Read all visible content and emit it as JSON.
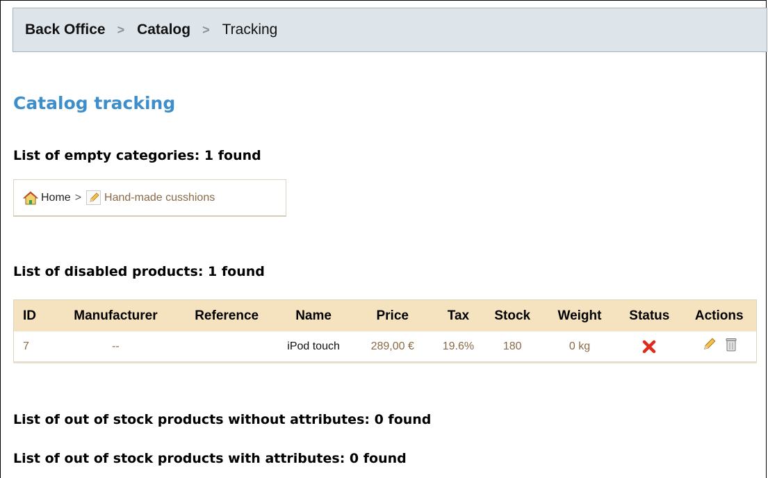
{
  "breadcrumb": {
    "items": [
      "Back Office",
      "Catalog",
      "Tracking"
    ],
    "separator": ">"
  },
  "page_title": "Catalog tracking",
  "empty_categories": {
    "heading": "List of empty categories: 1 found",
    "path_home": "Home",
    "path_separator": ">",
    "category": "Hand-made cusshions"
  },
  "disabled_products": {
    "heading": "List of disabled products: 1 found",
    "columns": [
      "ID",
      "Manufacturer",
      "Reference",
      "Name",
      "Price",
      "Tax",
      "Stock",
      "Weight",
      "Status",
      "Actions"
    ],
    "rows": [
      {
        "id": "7",
        "manufacturer": "--",
        "reference": "",
        "name": "iPod touch",
        "price": "289,00 €",
        "tax": "19.6%",
        "stock": "180",
        "weight": "0 kg",
        "status_icon": "red-x-icon",
        "actions": [
          "edit-icon",
          "delete-icon"
        ]
      }
    ]
  },
  "out_of_stock_without_attributes": {
    "heading": "List of out of stock products without attributes: 0 found"
  },
  "out_of_stock_with_attributes": {
    "heading": "List of out of stock products with attributes: 0 found"
  },
  "colors": {
    "title_blue": "#3d8ecb",
    "table_header": "#f5e3bf",
    "link_brown": "#8a6a45",
    "status_red": "#e02a1d",
    "breadcrumb_bg": "#dde4ea"
  }
}
